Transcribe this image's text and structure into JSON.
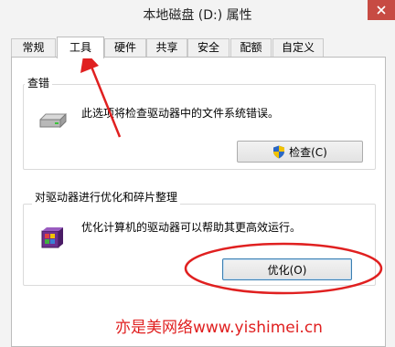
{
  "window": {
    "title": "本地磁盘 (D:) 属性",
    "close_icon": "close-icon"
  },
  "tabs": [
    {
      "label": "常规",
      "active": false
    },
    {
      "label": "工具",
      "active": true
    },
    {
      "label": "硬件",
      "active": false
    },
    {
      "label": "共享",
      "active": false
    },
    {
      "label": "安全",
      "active": false
    },
    {
      "label": "配额",
      "active": false
    },
    {
      "label": "自定义",
      "active": false
    }
  ],
  "error_check": {
    "title": "查错",
    "description": "此选项将检查驱动器中的文件系统错误。",
    "button_label": "检查(C)",
    "icon": "hard-drive-icon",
    "button_icon": "uac-shield-icon"
  },
  "optimize": {
    "title": "对驱动器进行优化和碎片整理",
    "description": "优化计算机的驱动器可以帮助其更高效运行。",
    "button_label": "优化(O)",
    "icon": "defrag-icon"
  },
  "annotation": {
    "watermark": "亦是美网络www.yishimei.cn",
    "color": "#e02020"
  }
}
